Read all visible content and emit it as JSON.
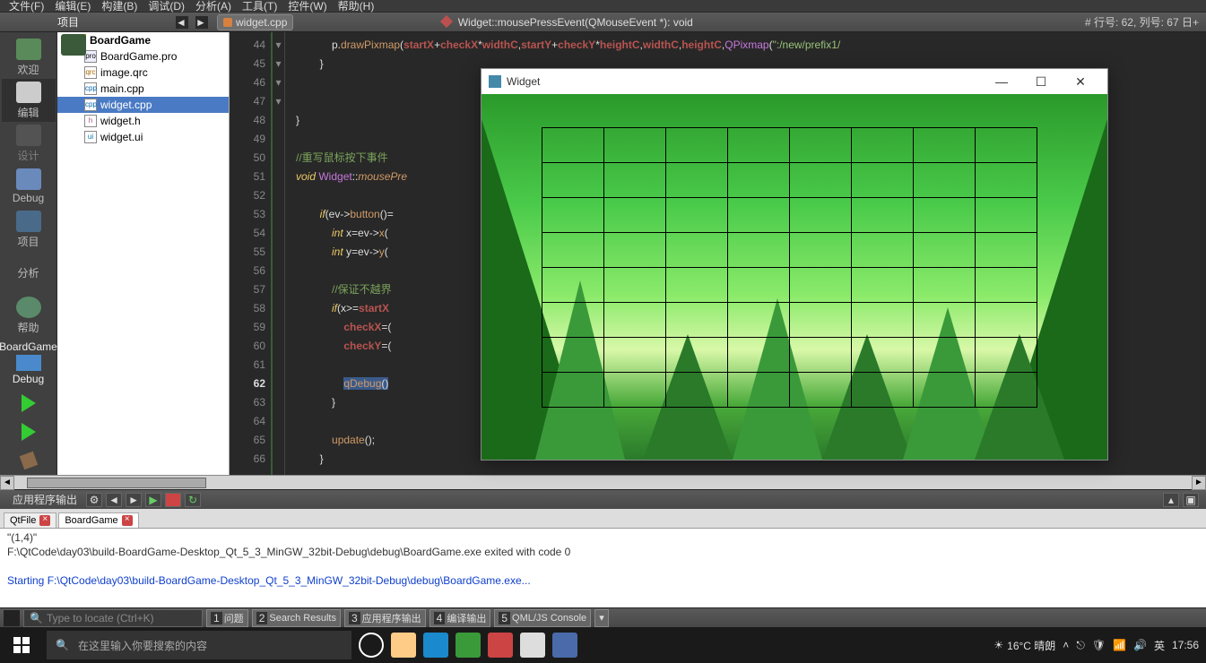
{
  "menubar": {
    "items": [
      "文件(F)",
      "编辑(E)",
      "构建(B)",
      "调试(D)",
      "分析(A)",
      "工具(T)",
      "控件(W)",
      "帮助(H)"
    ]
  },
  "toolbar": {
    "project_label": "项目",
    "file_tab": "widget.cpp",
    "func_sig": "Widget::mousePressEvent(QMouseEvent *): void",
    "line_info": "# 行号: 62, 列号: 67 日+"
  },
  "sidebar": {
    "items": [
      {
        "label": "欢迎"
      },
      {
        "label": "编辑"
      },
      {
        "label": "设计"
      },
      {
        "label": "Debug"
      },
      {
        "label": "项目"
      },
      {
        "label": "分析"
      },
      {
        "label": "帮助"
      }
    ],
    "target_name": "BoardGame",
    "target_mode": "Debug"
  },
  "project_tree": {
    "root": "BoardGame",
    "files": [
      {
        "name": "BoardGame.pro",
        "type": "pro"
      },
      {
        "name": "image.qrc",
        "type": "qrc"
      },
      {
        "name": "main.cpp",
        "type": "cpp"
      },
      {
        "name": "widget.cpp",
        "type": "cpp",
        "selected": true
      },
      {
        "name": "widget.h",
        "type": "h"
      },
      {
        "name": "widget.ui",
        "type": "ui"
      }
    ]
  },
  "editor": {
    "lines": [
      {
        "n": 44,
        "html": "            p.<span class='fn'>drawPixmap</span>(<span class='var'>startX</span>+<span class='var'>checkX</span>*<span class='var'>widthC</span>,<span class='var'>startY</span>+<span class='var'>checkY</span>*<span class='var'>heightC</span>,<span class='var'>widthC</span>,<span class='var'>heightC</span>,<span class='ty'>QPixmap</span>(<span class='str'>\":/new/prefix1/</span>"
      },
      {
        "n": 45,
        "html": "        }"
      },
      {
        "n": 46,
        "html": ""
      },
      {
        "n": 47,
        "html": ""
      },
      {
        "n": 48,
        "html": "}",
        "fold": "▾"
      },
      {
        "n": 49,
        "html": ""
      },
      {
        "n": 50,
        "html": "<span class='cm'>//重写鼠标按下事件</span>"
      },
      {
        "n": 51,
        "html": "<span class='kw'>void</span> <span class='ty'>Widget</span>::<span class='fnI'>mousePre</span>",
        "fold": "▾"
      },
      {
        "n": 52,
        "html": ""
      },
      {
        "n": 53,
        "html": "        <span class='kw'>if</span>(ev-><span class='fn'>button</span>()=",
        "fold": "▾"
      },
      {
        "n": 54,
        "html": "            <span class='kw'>int</span> x=ev-><span class='fn'>x</span>("
      },
      {
        "n": 55,
        "html": "            <span class='kw'>int</span> y=ev-><span class='fn'>y</span>("
      },
      {
        "n": 56,
        "html": ""
      },
      {
        "n": 57,
        "html": "            <span class='cm'>//保证不越界</span>"
      },
      {
        "n": 58,
        "html": "            <span class='kw'>if</span>(x>=<span class='var'>startX</span>",
        "fold": "▾"
      },
      {
        "n": 59,
        "html": "                <span class='var'>checkX</span>=("
      },
      {
        "n": 60,
        "html": "                <span class='var'>checkY</span>=("
      },
      {
        "n": 61,
        "html": ""
      },
      {
        "n": 62,
        "html": "                <span class='hi'><span class='fn'>qDebug</span>()</span>",
        "current": true
      },
      {
        "n": 63,
        "html": "            }"
      },
      {
        "n": 64,
        "html": ""
      },
      {
        "n": 65,
        "html": "            <span class='fn'>update</span>();"
      },
      {
        "n": 66,
        "html": "        }"
      }
    ]
  },
  "output": {
    "header": "应用程序输出",
    "tabs": [
      {
        "name": "QtFile"
      },
      {
        "name": "BoardGame",
        "active": true
      }
    ],
    "lines": [
      {
        "text": "\"(1,4)\"",
        "cls": ""
      },
      {
        "text": "F:\\QtCode\\day03\\build-BoardGame-Desktop_Qt_5_3_MinGW_32bit-Debug\\debug\\BoardGame.exe exited with code 0",
        "cls": ""
      },
      {
        "text": "",
        "cls": ""
      },
      {
        "text": "Starting F:\\QtCode\\day03\\build-BoardGame-Desktop_Qt_5_3_MinGW_32bit-Debug\\debug\\BoardGame.exe...",
        "cls": "blue"
      }
    ]
  },
  "statusbar": {
    "locate_placeholder": "Type to locate (Ctrl+K)",
    "panels": [
      {
        "n": "1",
        "label": "问题"
      },
      {
        "n": "2",
        "label": "Search Results"
      },
      {
        "n": "3",
        "label": "应用程序输出"
      },
      {
        "n": "4",
        "label": "编译输出"
      },
      {
        "n": "5",
        "label": "QML/JS Console"
      }
    ]
  },
  "taskbar": {
    "search_placeholder": "在这里输入你要搜索的内容",
    "weather": "16°C 晴朗",
    "ime": "英",
    "time": "17:56"
  },
  "appwin": {
    "title": "Widget"
  }
}
